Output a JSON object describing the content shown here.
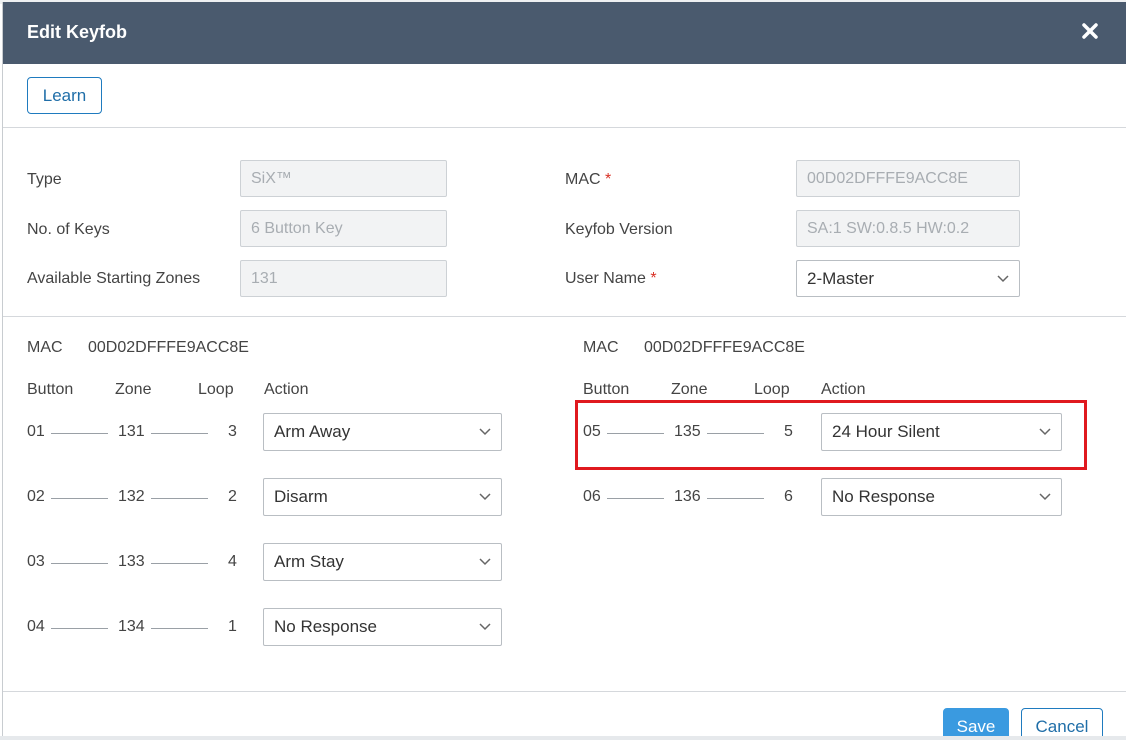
{
  "dialog": {
    "title": "Edit Keyfob"
  },
  "toolbar": {
    "learn_label": "Learn"
  },
  "info": {
    "type_label": "Type",
    "type_value": "SiX™",
    "keys_label": "No. of Keys",
    "keys_value": "6 Button Key",
    "zones_label": "Available Starting Zones",
    "zones_value": "131",
    "mac_label": "MAC",
    "mac_value": "00D02DFFFE9ACC8E",
    "version_label": "Keyfob Version",
    "version_value": "SA:1 SW:0.8.5 HW:0.2",
    "user_label": "User Name",
    "user_value": "2-Master",
    "required_mark": "*"
  },
  "buttons_section": {
    "mac_label": "MAC",
    "mac_value": "00D02DFFFE9ACC8E",
    "headers": {
      "button": "Button",
      "zone": "Zone",
      "loop": "Loop",
      "action": "Action"
    },
    "left_rows": [
      {
        "button": "01",
        "zone": "131",
        "loop": "3",
        "action": "Arm Away"
      },
      {
        "button": "02",
        "zone": "132",
        "loop": "2",
        "action": "Disarm"
      },
      {
        "button": "03",
        "zone": "133",
        "loop": "4",
        "action": "Arm Stay"
      },
      {
        "button": "04",
        "zone": "134",
        "loop": "1",
        "action": "No Response"
      }
    ],
    "right_rows": [
      {
        "button": "05",
        "zone": "135",
        "loop": "5",
        "action": "24 Hour Silent"
      },
      {
        "button": "06",
        "zone": "136",
        "loop": "6",
        "action": "No Response"
      }
    ]
  },
  "footer": {
    "save_label": "Save",
    "cancel_label": "Cancel"
  },
  "colors": {
    "header_bg": "#4a5a6e",
    "accent": "#1f7bbf",
    "save_bg": "#3a9ae0",
    "highlight": "#e0191f"
  },
  "icons": {
    "close": "close-icon",
    "chevron": "chevron-down-icon"
  }
}
